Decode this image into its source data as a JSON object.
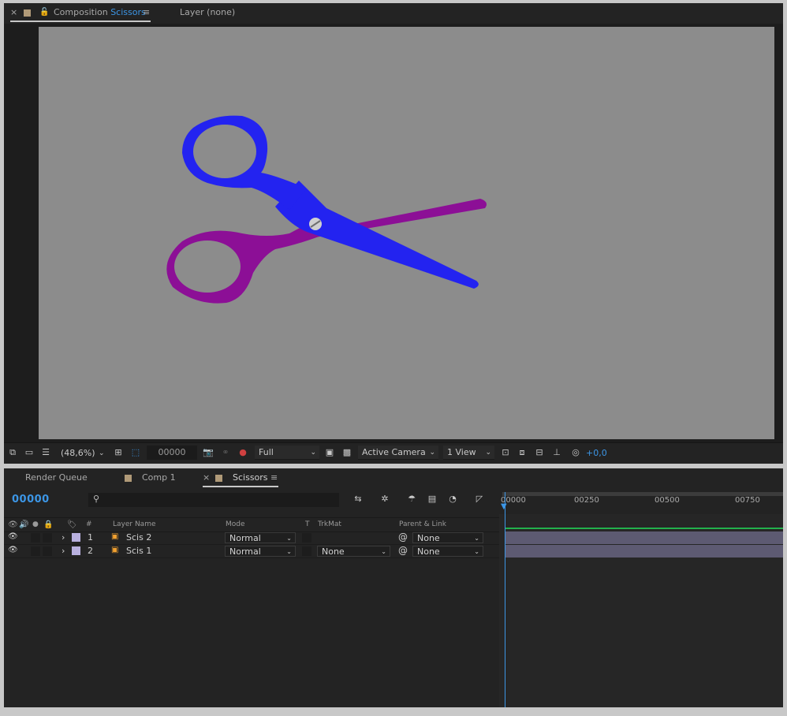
{
  "composition_panel": {
    "close_glyph": "×",
    "tab_prefix": "Composition",
    "comp_name": "Scissors",
    "menu_glyph": "≡",
    "layer_tab": "Layer (none)",
    "toolbar": {
      "zoom": "(48,6%)",
      "timecode": "00000",
      "resolution": "Full",
      "camera": "Active Camera",
      "views": "1 View",
      "exposure": "+0,0"
    },
    "scissors_colors": {
      "blade_a": "#2323f0",
      "blade_b": "#8c0f96",
      "screw": "#c8c8c8"
    }
  },
  "timeline_panel": {
    "tabs": [
      {
        "label": "Render Queue"
      },
      {
        "label": "Comp 1"
      },
      {
        "label": "Scissors"
      }
    ],
    "close_glyph": "×",
    "menu_glyph": "≡",
    "current_time": "00000",
    "search_placeholder": "",
    "columns": {
      "number": "#",
      "layer_name": "Layer Name",
      "mode": "Mode",
      "t": "T",
      "trkmat": "TrkMat",
      "parent": "Parent & Link"
    },
    "layers": [
      {
        "index": "1",
        "name": "Scis 2",
        "mode": "Normal",
        "trkmat": "",
        "parent": "None"
      },
      {
        "index": "2",
        "name": "Scis 1",
        "mode": "Normal",
        "trkmat": "None",
        "parent": "None"
      }
    ],
    "ruler_ticks": [
      "00000",
      "00250",
      "00500",
      "00750"
    ],
    "colors": {
      "accent": "#3c96e6",
      "layer_label": "#b8b0de",
      "track_bar": "#5d5a72",
      "work_area_line": "#22b14c"
    }
  }
}
